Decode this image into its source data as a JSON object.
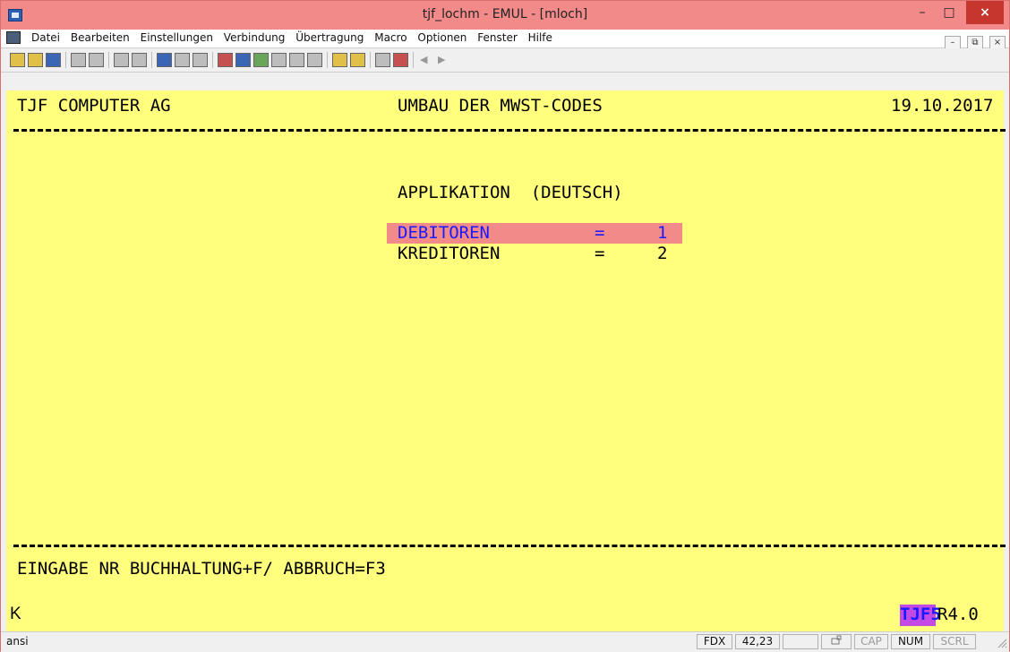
{
  "window": {
    "title": "tjf_lochm - EMUL - [mloch]",
    "controls": {
      "minimize": "–",
      "maximize": "□",
      "close": "×"
    }
  },
  "menu": {
    "items": [
      {
        "label": "Datei"
      },
      {
        "label": "Bearbeiten"
      },
      {
        "label": "Einstellungen"
      },
      {
        "label": "Verbindung"
      },
      {
        "label": "Übertragung"
      },
      {
        "label": "Macro"
      },
      {
        "label": "Optionen"
      },
      {
        "label": "Fenster"
      },
      {
        "label": "Hilfe"
      }
    ],
    "mdi": {
      "minimize": "–",
      "restore": "⧉",
      "close": "×"
    }
  },
  "toolbar": {
    "buttons": [
      {
        "icon": "wizard-icon"
      },
      {
        "icon": "open-folder-icon"
      },
      {
        "icon": "save-icon"
      },
      {
        "icon": "print-icon"
      },
      {
        "icon": "print-setup-icon"
      },
      {
        "icon": "copy-icon"
      },
      {
        "icon": "paste-icon"
      },
      {
        "icon": "font-size-icon"
      },
      {
        "icon": "font-increase-icon"
      },
      {
        "icon": "font-decrease-icon"
      },
      {
        "icon": "palette-icon"
      },
      {
        "icon": "keyboard-icon"
      },
      {
        "icon": "macro-icon"
      },
      {
        "icon": "undo-icon"
      },
      {
        "icon": "send-icon"
      },
      {
        "icon": "settings-icon"
      },
      {
        "icon": "transfer-up-icon"
      },
      {
        "icon": "transfer-down-icon"
      },
      {
        "icon": "calculator-icon"
      },
      {
        "icon": "network-icon"
      }
    ],
    "nav": {
      "prev": "◀",
      "next": "▶"
    }
  },
  "terminal": {
    "company": "TJF COMPUTER AG",
    "screen_title": "UMBAU DER MWST-CODES",
    "date": "19.10.2017",
    "section_title": "APPLIKATION  (DEUTSCH)",
    "options": [
      {
        "label": "DEBITOREN",
        "sep": "=",
        "value": "1"
      },
      {
        "label": "KREDITOREN",
        "sep": "=",
        "value": "2"
      }
    ],
    "prompt": "EINGABE NR BUCHHALTUNG+F/ ABBRUCH=F3",
    "cursor": "K",
    "badge": "TJF5",
    "version": "R4.0"
  },
  "status": {
    "left": "ansi",
    "mode": "FDX",
    "cursor_pos": "42,23",
    "cap": "CAP",
    "num": "NUM",
    "scrl": "SCRL"
  },
  "colors": {
    "titlebar": "#f28a8a",
    "terminal_bg": "#fffe7d",
    "highlight": "#f28a8a",
    "badge": "#c44ae6",
    "blue_text": "#1a1aff"
  }
}
